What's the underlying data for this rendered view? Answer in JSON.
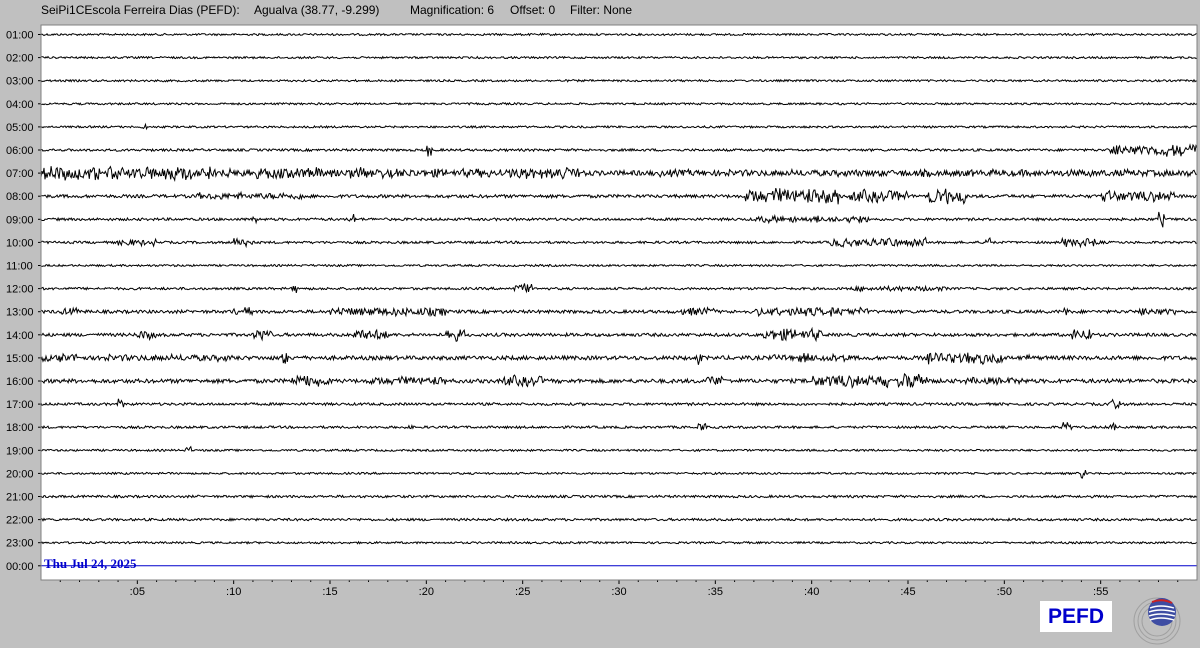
{
  "header": {
    "station": "SeiPi1CEscola Ferreira Dias (PEFD):",
    "location": "Agualva (38.77, -9.299)",
    "magnification": "Magnification: 6",
    "offset": "Offset: 0",
    "filter": "Filter: None"
  },
  "logo": {
    "text": "PEFD"
  },
  "colors": {
    "background": "#c0c0c0",
    "plot": "#ffffff",
    "trace": "#000000",
    "current_hour": "#0000cc"
  },
  "chart_data": {
    "type": "line",
    "title": "",
    "xlabel": "",
    "ylabel": "",
    "date_label": "Thu Jul 24, 2025",
    "xlim": [
      0,
      60
    ],
    "x_ticks": [
      ":05",
      ":10",
      ":15",
      ":20",
      ":25",
      ":30",
      ":35",
      ":40",
      ":45",
      ":50",
      ":55"
    ],
    "x_tick_values": [
      5,
      10,
      15,
      20,
      25,
      30,
      35,
      40,
      45,
      50,
      55
    ],
    "rows": [
      {
        "hour": "01:00",
        "base": 1,
        "bursts": []
      },
      {
        "hour": "02:00",
        "base": 1,
        "bursts": []
      },
      {
        "hour": "03:00",
        "base": 1,
        "bursts": []
      },
      {
        "hour": "04:00",
        "base": 1,
        "bursts": []
      },
      {
        "hour": "05:00",
        "base": 1,
        "bursts": [
          [
            5.2,
            0.3,
            3
          ]
        ]
      },
      {
        "hour": "06:00",
        "base": 1.2,
        "bursts": [
          [
            20,
            0.3,
            9
          ],
          [
            55.5,
            4.5,
            7
          ]
        ]
      },
      {
        "hour": "07:00",
        "base": 2.5,
        "bursts": [
          [
            0,
            9,
            8
          ],
          [
            9,
            9,
            6
          ],
          [
            18,
            10,
            5
          ],
          [
            24,
            4,
            7
          ],
          [
            32,
            20,
            4
          ],
          [
            52,
            8,
            4
          ]
        ]
      },
      {
        "hour": "08:00",
        "base": 1.6,
        "bursts": [
          [
            8,
            6,
            4
          ],
          [
            36.5,
            5,
            9
          ],
          [
            42,
            3,
            7
          ],
          [
            46,
            2,
            10
          ],
          [
            55,
            4,
            6
          ]
        ]
      },
      {
        "hour": "09:00",
        "base": 1.3,
        "bursts": [
          [
            11,
            0.3,
            5
          ],
          [
            16,
            0.3,
            8
          ],
          [
            37,
            6,
            4
          ],
          [
            58,
            0.3,
            9
          ]
        ]
      },
      {
        "hour": "10:00",
        "base": 1.2,
        "bursts": [
          [
            4,
            2,
            4
          ],
          [
            10,
            1,
            6
          ],
          [
            41,
            5,
            5
          ],
          [
            49,
            0.3,
            6
          ],
          [
            53,
            2,
            5
          ]
        ]
      },
      {
        "hour": "11:00",
        "base": 1,
        "bursts": []
      },
      {
        "hour": "12:00",
        "base": 1.2,
        "bursts": [
          [
            13,
            0.3,
            5
          ],
          [
            24.5,
            1,
            6
          ],
          [
            42,
            5,
            3
          ]
        ]
      },
      {
        "hour": "13:00",
        "base": 1.6,
        "bursts": [
          [
            1,
            1,
            4
          ],
          [
            10,
            1,
            5
          ],
          [
            15,
            6,
            5
          ],
          [
            33,
            2,
            5
          ],
          [
            37,
            6,
            5
          ],
          [
            53,
            0.3,
            9
          ],
          [
            57,
            2,
            5
          ]
        ]
      },
      {
        "hour": "14:00",
        "base": 1.6,
        "bursts": [
          [
            5,
            1,
            5
          ],
          [
            11,
            1,
            6
          ],
          [
            16,
            2,
            6
          ],
          [
            21,
            1,
            7
          ],
          [
            37.5,
            3,
            7
          ],
          [
            53.5,
            1,
            8
          ]
        ]
      },
      {
        "hour": "15:00",
        "base": 2,
        "bursts": [
          [
            0,
            2,
            5
          ],
          [
            3,
            7,
            4
          ],
          [
            12.5,
            0.3,
            8
          ],
          [
            34,
            0.3,
            8
          ],
          [
            38,
            4,
            5
          ],
          [
            46,
            4,
            7
          ],
          [
            51,
            0.3,
            6
          ]
        ]
      },
      {
        "hour": "16:00",
        "base": 2,
        "bursts": [
          [
            13,
            2,
            7
          ],
          [
            17,
            4,
            5
          ],
          [
            24,
            2,
            6
          ],
          [
            34.5,
            1,
            6
          ],
          [
            40,
            4,
            7
          ],
          [
            44.5,
            1.5,
            9
          ],
          [
            48,
            3,
            4
          ]
        ]
      },
      {
        "hour": "17:00",
        "base": 1.3,
        "bursts": [
          [
            4,
            0.3,
            7
          ],
          [
            55.5,
            0.5,
            6
          ]
        ]
      },
      {
        "hour": "18:00",
        "base": 1.2,
        "bursts": [
          [
            19,
            0.3,
            4
          ],
          [
            34,
            0.5,
            5
          ],
          [
            53,
            0.5,
            6
          ],
          [
            55.5,
            0.3,
            7
          ]
        ]
      },
      {
        "hour": "19:00",
        "base": 1,
        "bursts": [
          [
            7.5,
            0.3,
            5
          ]
        ]
      },
      {
        "hour": "20:00",
        "base": 1,
        "bursts": [
          [
            54,
            0.3,
            7
          ]
        ]
      },
      {
        "hour": "21:00",
        "base": 1.2,
        "bursts": []
      },
      {
        "hour": "22:00",
        "base": 1.2,
        "bursts": []
      },
      {
        "hour": "23:00",
        "base": 1,
        "bursts": []
      },
      {
        "hour": "00:00",
        "base": 0,
        "bursts": [],
        "partial": true
      }
    ]
  }
}
